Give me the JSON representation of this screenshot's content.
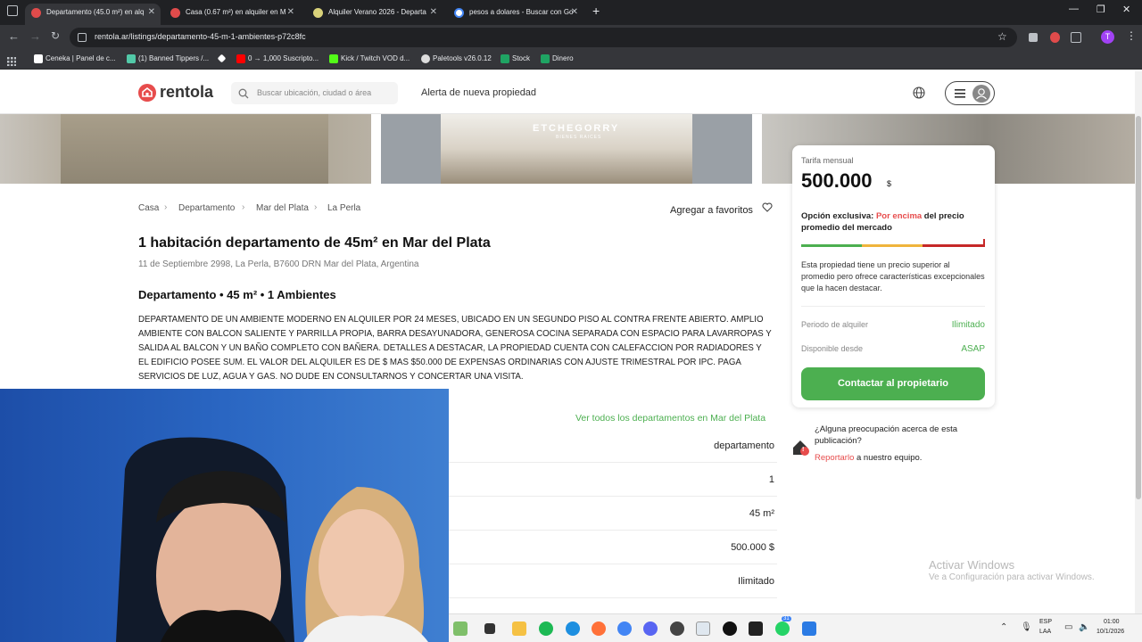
{
  "browser": {
    "tabs": [
      {
        "title": "Departamento (45.0 m²) en alq",
        "active": true,
        "icon_color": "#e04b4b"
      },
      {
        "title": "Casa (0.67 m²) en alquiler en M",
        "active": false,
        "icon_color": "#e04b4b"
      },
      {
        "title": "Alquiler Verano 2026 - Departa",
        "active": false,
        "icon_color": "#d9d27a"
      },
      {
        "title": "pesos a dolares - Buscar con Go",
        "active": false,
        "icon_color": "#ffffff"
      }
    ],
    "new_tab": "+",
    "url": "rentola.ar/listings/departamento-45-m-1-ambientes-p72c8fc",
    "profile_initial": "T",
    "bookmarks": [
      {
        "label": "Ceneka | Panel de c...",
        "color": "#ffffff"
      },
      {
        "label": "(1) Banned Tippers /...",
        "color": "#52c9a8"
      },
      {
        "label": "",
        "color": "#ffffff"
      },
      {
        "label": "0 → 1,000 Suscripto...",
        "color": "#ff0000"
      },
      {
        "label": "Kick / Twitch VOD d...",
        "color": "#53fc18"
      },
      {
        "label": "Paletools v26.0.12",
        "color": "#dddddd"
      },
      {
        "label": "Stock",
        "color": "#1fa463"
      },
      {
        "label": "Dinero",
        "color": "#1fa463"
      }
    ]
  },
  "site": {
    "logo_text": "rentola",
    "search_placeholder": "Buscar ubicación, ciudad o área",
    "alert_link": "Alerta de nueva propiedad",
    "photo_watermark": "ETCHEGORRY",
    "photo_watermark_sub": "BIENES RAICES"
  },
  "breadcrumb": [
    "Casa",
    "Departamento",
    "Mar del Plata",
    "La Perla"
  ],
  "favorites_label": "Agregar a favoritos",
  "listing": {
    "title": "1 habitación departamento de 45m² en Mar del Plata",
    "address": "11 de Septiembre 2998, La Perla, B7600 DRN Mar del Plata, Argentina",
    "subtitle": "Departamento • 45 m² • 1 Ambientes",
    "description": "DEPARTAMENTO DE UN AMBIENTE MODERNO EN ALQUILER POR 24 MESES, UBICADO EN UN SEGUNDO PISO AL CONTRA FRENTE ABIERTO. AMPLIO AMBIENTE CON BALCON SALIENTE Y PARRILLA PROPIA, BARRA DESAYUNADORA, GENEROSA COCINA SEPARADA CON ESPACIO PARA LAVARROPAS Y SALIDA AL BALCON Y UN BAÑO COMPLETO CON BAÑERA. DETALLES A DESTACAR, LA PROPIEDAD CUENTA CON CALEFACCION POR RADIADORES Y EL EDIFICIO POSEE SUM. EL VALOR DEL ALQUILER ES DE $ MAS $50.000 DE EXPENSAS ORDINARIAS CON AJUSTE TRIMESTRAL POR IPC. PAGA SERVICIOS DE LUZ, AGUA Y GAS. NO DUDE EN CONSULTARNOS Y CONCERTAR UNA VISITA.",
    "see_all_link": "Ver todos los departamentos en Mar del Plata",
    "details": [
      "departamento",
      "1",
      "45 m²",
      "500.000 $",
      "Ilimitado"
    ]
  },
  "price_card": {
    "label": "Tarifa mensual",
    "price": "500.000",
    "currency": "$",
    "option_prefix": "Opción exclusiva: ",
    "option_highlight": "Por encima",
    "option_suffix": " del precio promedio del mercado",
    "explanation": "Esta propiedad tiene un precio superior al promedio pero ofrece características excepcionales que la hacen destacar.",
    "rental_period_label": "Periodo de alquiler",
    "rental_period_value": "Ilimitado",
    "available_label": "Disponible desde",
    "available_value": "ASAP",
    "contact_button": "Contactar al propietario"
  },
  "report": {
    "question": "¿Alguna preocupación acerca de esta publicación?",
    "link": "Reportarlo",
    "suffix": " a nuestro equipo.",
    "badge": "!"
  },
  "windows": {
    "watermark_title": "Activar Windows",
    "watermark_sub": "Ve a Configuración para activar Windows.",
    "lang_top": "ESP",
    "lang_bottom": "LAA",
    "time": "01:00",
    "date": "10/1/2026",
    "badge_count": "31"
  },
  "colors": {
    "brand_red": "#e74c4c",
    "green": "#4caf50",
    "tab_bg": "#202124",
    "toolbar_bg": "#35363a"
  }
}
